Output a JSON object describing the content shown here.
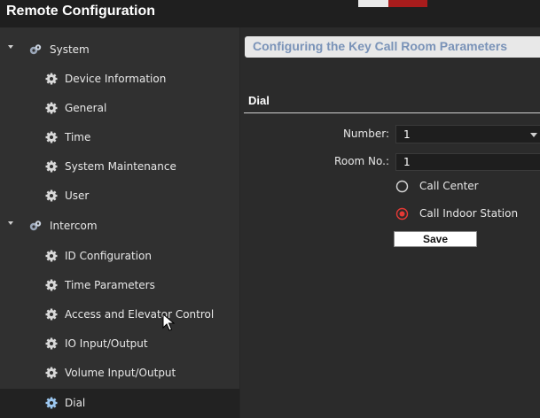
{
  "app": {
    "title": "Remote Configuration"
  },
  "sidebar": {
    "groups": [
      {
        "label": "System",
        "items": [
          {
            "label": "Device Information"
          },
          {
            "label": "General"
          },
          {
            "label": "Time"
          },
          {
            "label": "System Maintenance"
          },
          {
            "label": "User"
          }
        ]
      },
      {
        "label": "Intercom",
        "items": [
          {
            "label": "ID Configuration"
          },
          {
            "label": "Time Parameters"
          },
          {
            "label": "Access and Elevator Control"
          },
          {
            "label": "IO Input/Output"
          },
          {
            "label": "Volume Input/Output"
          },
          {
            "label": "Dial"
          }
        ]
      }
    ],
    "selected": "Dial"
  },
  "main": {
    "title": "Configuring the Key Call Room Parameters",
    "section": "Dial",
    "number": {
      "label": "Number:",
      "value": "1"
    },
    "room": {
      "label": "Room No.:",
      "value": "1"
    },
    "options": [
      {
        "label": "Call Center",
        "checked": false
      },
      {
        "label": "Call Indoor Station",
        "checked": true
      }
    ],
    "save_label": "Save"
  },
  "colors": {
    "accent_radio": "#e53935",
    "header_text": "#7a93b8"
  }
}
